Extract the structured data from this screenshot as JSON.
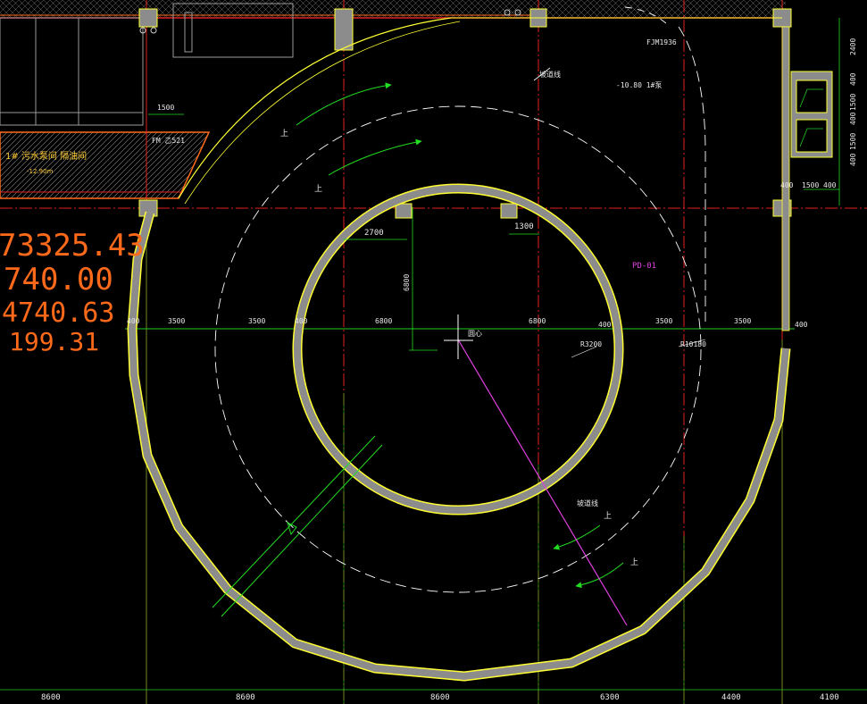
{
  "colors": {
    "background": "#000000",
    "wall_fill": "#8c8c8c",
    "wall_edge": "#ffff33",
    "axis_red": "#e02020",
    "axis_green": "#22cc22",
    "dim_line": "#22dd22",
    "ramp_arrow": "#22dd22",
    "text": "#e8e8e8",
    "orange": "#ff6a1a",
    "magenta": "#e040e0"
  },
  "coords": {
    "line1": "73325.43",
    "line2": "740.00",
    "line3": "4740.63",
    "line4": "199.31"
  },
  "bottom_dims": [
    "8600",
    "8600",
    "8600",
    "6300",
    "4400",
    "4100"
  ],
  "mid_dims": {
    "left_wall": "400",
    "d1": "3500",
    "d2": "3500",
    "d3": "400",
    "d4": "6800",
    "d5": "6800",
    "d6": "400",
    "d7": "3500",
    "d8": "3500",
    "right_wall": "400"
  },
  "right_dims": {
    "v1": "2400",
    "v2": "400",
    "v3": "1500",
    "v4": "400",
    "v5": "1500",
    "v6": "400",
    "h1": "400",
    "h2": "1500",
    "h3": "400"
  },
  "labels": {
    "dim_2700": "2700",
    "dim_1300": "1300",
    "dim_6800_v": "6800",
    "dim_1500_top": "1500",
    "center": "圆心",
    "radius_inner": "R3200",
    "radius_outer": "R10180",
    "fm_door": "FM 乙521",
    "fjm_door": "FJM1936",
    "ramp_left": "坡道线",
    "ramp_bottom": "坡道线",
    "room": "1#  污水泵间  隔油间",
    "room_sub": "-12.90m",
    "pump_note": "-10.80  1#泵",
    "pd_tag": "PD-01",
    "up1": "上",
    "up2": "上",
    "up3": "上",
    "up4": "上"
  }
}
